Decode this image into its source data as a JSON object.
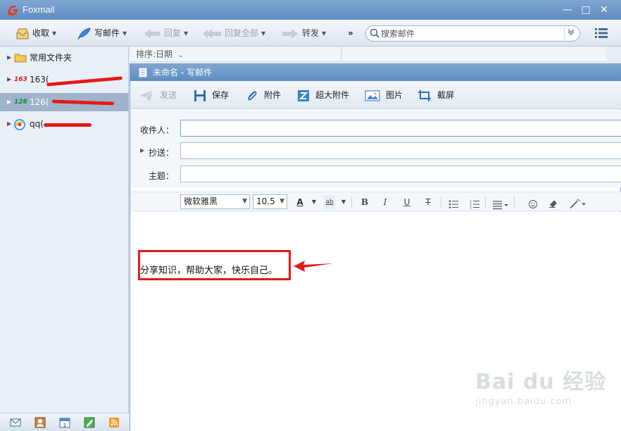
{
  "app": {
    "title": "Foxmail",
    "brand_color": "#e23b2b"
  },
  "window_controls": {
    "minimize": "—",
    "maximize": "□",
    "close": "✕"
  },
  "toolbar": {
    "receive": "收取",
    "compose": "写邮件",
    "reply": "回复",
    "reply_all": "回复全部",
    "forward": "转发",
    "more": "»",
    "search_placeholder": "搜索邮件",
    "search_dropdown": "⌄"
  },
  "mail_list": {
    "sort_label": "排序:日期"
  },
  "sidebar": {
    "items": [
      {
        "label": "常用文件夹",
        "icon": "folder-icon"
      },
      {
        "label": "163(",
        "badge": "163",
        "icon": "mail-163-icon"
      },
      {
        "label": "126(",
        "badge": "126",
        "icon": "mail-126-icon",
        "selected": true
      },
      {
        "label": "qq(",
        "icon": "qq-mail-icon"
      }
    ],
    "bottom_icons": [
      "mail-icon",
      "contacts-icon",
      "calendar-icon",
      "notes-icon",
      "rss-icon"
    ]
  },
  "compose": {
    "window_title": "未命名 - 写邮件",
    "toolbar": {
      "send": "发送",
      "save": "保存",
      "attach": "附件",
      "big_attach": "超大附件",
      "image": "图片",
      "screenshot": "截屏"
    },
    "fields": {
      "to_label": "收件人：",
      "cc_label": "抄送：",
      "subject_label": "主题：",
      "to_value": "",
      "cc_value": "",
      "subject_value": ""
    },
    "format": {
      "font": "微软雅黑",
      "size": "10.5",
      "font_color": "A",
      "highlight": "ab",
      "bold": "B",
      "italic": "I",
      "underline": "U",
      "strike": "T"
    },
    "body_text": "分享知识，帮助大家，快乐自己。"
  },
  "watermark": {
    "line1": "Bai du 经验",
    "line2": "jingyan.baidu.com"
  }
}
